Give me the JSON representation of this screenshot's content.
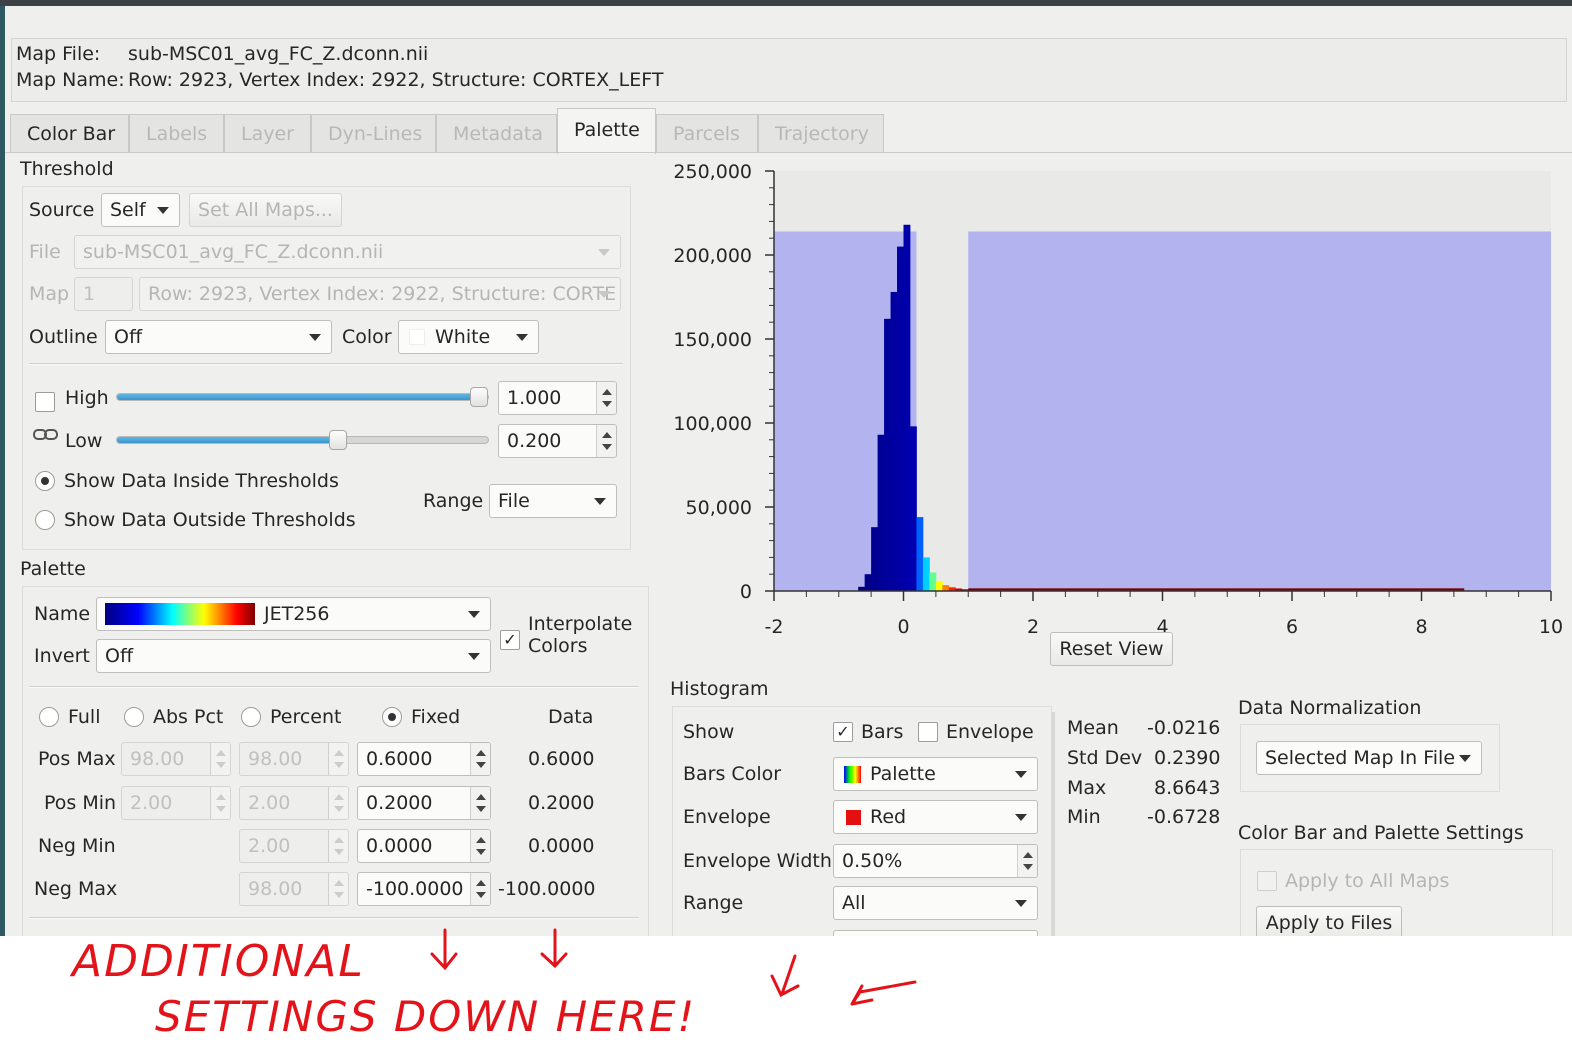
{
  "map_info": {
    "file_label": "Map File:",
    "file_value": "sub-MSC01_avg_FC_Z.dconn.nii",
    "name_label": "Map Name:",
    "name_value": "Row: 2923, Vertex Index: 2922, Structure: CORTEX_LEFT"
  },
  "tabs": [
    {
      "label": "Color Bar",
      "state": "enabled"
    },
    {
      "label": "Labels",
      "state": "disabled"
    },
    {
      "label": "Layer",
      "state": "disabled"
    },
    {
      "label": "Dyn-Lines",
      "state": "disabled"
    },
    {
      "label": "Metadata",
      "state": "disabled"
    },
    {
      "label": "Palette",
      "state": "active"
    },
    {
      "label": "Parcels",
      "state": "disabled"
    },
    {
      "label": "Trajectory",
      "state": "disabled"
    }
  ],
  "threshold": {
    "title": "Threshold",
    "source_label": "Source",
    "source_value": "Self",
    "set_all_maps": "Set All Maps...",
    "file_label": "File",
    "file_value": "sub-MSC01_avg_FC_Z.dconn.nii",
    "map_label": "Map",
    "map_index": "1",
    "map_value": "Row: 2923, Vertex Index: 2922, Structure: CORTE",
    "outline_label": "Outline",
    "outline_value": "Off",
    "color_label": "Color",
    "color_value": "White",
    "high_label": "High",
    "high_value": "1.000",
    "high_checked": false,
    "high_slider_fraction": 1.0,
    "low_label": "Low",
    "low_value": "0.200",
    "low_slider_fraction": 0.6,
    "show_inside": "Show Data Inside Thresholds",
    "show_outside": "Show Data Outside Thresholds",
    "show_mode": "inside",
    "range_label": "Range",
    "range_value": "File"
  },
  "palette": {
    "title": "Palette",
    "name_label": "Name",
    "name_value": "JET256",
    "interpolate_label_1": "Interpolate",
    "interpolate_label_2": "Colors",
    "interpolate_checked": true,
    "invert_label": "Invert",
    "invert_value": "Off",
    "mode_full": "Full",
    "mode_abs_pct": "Abs Pct",
    "mode_percent": "Percent",
    "mode_fixed": "Fixed",
    "data_header": "Data",
    "mode_selected": "Fixed",
    "rows": [
      {
        "label": "Pos Max",
        "abs_pct": "98.00",
        "percent": "98.00",
        "fixed": "0.6000",
        "data": "0.6000"
      },
      {
        "label": "Pos Min",
        "abs_pct": "2.00",
        "percent": "2.00",
        "fixed": "0.2000",
        "data": "0.2000"
      },
      {
        "label": "Neg Min",
        "abs_pct": "",
        "percent": "2.00",
        "fixed": "0.0000",
        "data": "0.0000"
      },
      {
        "label": "Neg Max",
        "abs_pct": "",
        "percent": "98.00",
        "fixed": "-100.0000",
        "data": "-100.0000"
      }
    ]
  },
  "chart_data": {
    "type": "bar",
    "title": "",
    "xlabel": "",
    "ylabel": "",
    "xlim": [
      -2,
      10
    ],
    "ylim": [
      0,
      250000
    ],
    "x_ticks": [
      "-2",
      "0",
      "2",
      "4",
      "6",
      "8",
      "10"
    ],
    "y_ticks": [
      "250,000",
      "200,000",
      "150,000",
      "100,000",
      "50,000",
      "0"
    ],
    "threshold_shading": {
      "color": "#b3b3f0",
      "height": 214000,
      "ranges": [
        [
          -2,
          0.2
        ],
        [
          1.0,
          10
        ]
      ]
    },
    "bins": [
      {
        "x": -0.65,
        "y": 2500,
        "color": "#000080"
      },
      {
        "x": -0.55,
        "y": 10000,
        "color": "#00008a"
      },
      {
        "x": -0.45,
        "y": 38000,
        "color": "#000090"
      },
      {
        "x": -0.35,
        "y": 93000,
        "color": "#000096"
      },
      {
        "x": -0.25,
        "y": 162000,
        "color": "#00009b"
      },
      {
        "x": -0.15,
        "y": 178000,
        "color": "#0000a0"
      },
      {
        "x": -0.05,
        "y": 205000,
        "color": "#0000a5"
      },
      {
        "x": 0.05,
        "y": 218000,
        "color": "#0000aa"
      },
      {
        "x": 0.15,
        "y": 98000,
        "color": "#0000b0"
      },
      {
        "x": 0.25,
        "y": 44000,
        "color": "#0060ff"
      },
      {
        "x": 0.35,
        "y": 20000,
        "color": "#00d0ff"
      },
      {
        "x": 0.45,
        "y": 11000,
        "color": "#60ff90"
      },
      {
        "x": 0.55,
        "y": 6000,
        "color": "#ffff00"
      },
      {
        "x": 0.65,
        "y": 3500,
        "color": "#ff8000"
      },
      {
        "x": 0.75,
        "y": 2200,
        "color": "#ff2000"
      },
      {
        "x": 0.85,
        "y": 1500,
        "color": "#cc0000"
      },
      {
        "x": 0.95,
        "y": 1000,
        "color": "#800000"
      }
    ],
    "tail": {
      "from": 1.0,
      "to": 8.66,
      "y": 400,
      "color": "#800000"
    },
    "reset_view": "Reset View"
  },
  "histogram": {
    "title": "Histogram",
    "show_label": "Show",
    "bars_label": "Bars",
    "bars_checked": true,
    "envelope_check_label": "Envelope",
    "envelope_checked": false,
    "bars_color_label": "Bars Color",
    "bars_color_value": "Palette",
    "envelope_label": "Envelope",
    "envelope_value": "Red",
    "envelope_swatch": "#e41010",
    "envelope_width_label": "Envelope Width",
    "envelope_width_value": "0.50%",
    "range_label": "Range",
    "range_value": "All"
  },
  "stats": [
    {
      "label": "Mean",
      "value": "-0.0216"
    },
    {
      "label": "Std Dev",
      "value": "0.2390"
    },
    {
      "label": "Max",
      "value": "8.6643"
    },
    {
      "label": "Min",
      "value": "-0.6728"
    }
  ],
  "normalization": {
    "title": "Data Normalization",
    "value": "Selected Map In File"
  },
  "settings": {
    "title": "Color Bar and Palette Settings",
    "apply_all": "Apply to All Maps",
    "apply_files": "Apply to Files"
  },
  "annotation": {
    "line1": "ADDITIONAL",
    "line2": "SETTINGS DOWN HERE!",
    "color": "#e2141a"
  }
}
